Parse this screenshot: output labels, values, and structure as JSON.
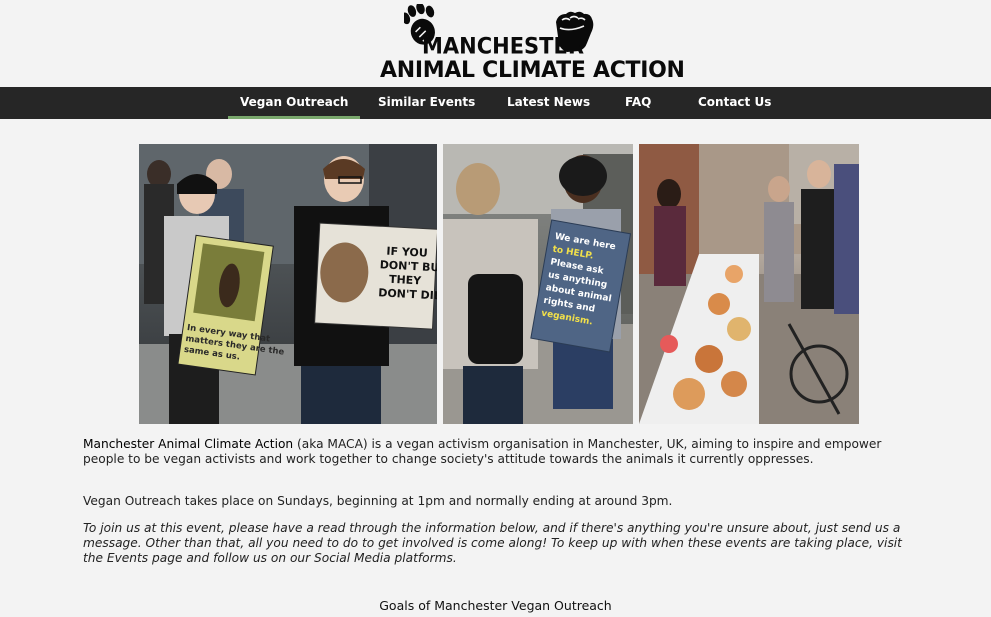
{
  "logo": {
    "line1": "MANCHESTER",
    "line2": "ANIMAL CLIMATE ACTION"
  },
  "nav": {
    "items": [
      {
        "label": "Vegan Outreach",
        "active": true
      },
      {
        "label": "Similar Events",
        "active": false
      },
      {
        "label": "Latest News",
        "active": false
      },
      {
        "label": "FAQ",
        "active": false
      },
      {
        "label": "Contact Us",
        "active": false
      }
    ],
    "accent_color": "#7aa86d",
    "bar_color": "#262626"
  },
  "photos": {
    "sign1_lines": [
      "In every way that",
      "matters they are the",
      "same as us."
    ],
    "sign2_lines": [
      "IF YOU",
      "DON'T BUY",
      "THEY",
      "DON'T DIE!"
    ],
    "sign3_lines": [
      "We are here",
      "to HELP.",
      "Please ask",
      "us anything",
      "about animal",
      "rights and",
      "veganism."
    ]
  },
  "content": {
    "intro_brand": "Manchester Animal Climate Action",
    "intro_rest": " (aka MACA) is a vegan activism organisation in Manchester, UK, aiming to inspire and empower people to be vegan activists and work together to change society's attitude towards the animals it currently oppresses.",
    "when": "Vegan Outreach takes place on Sundays, beginning at 1pm and normally ending at around 3pm.",
    "join": "To join us at this event, please have a read through the information below, and if there's anything you're unsure about, just send us a message. Other than that, all you need to do to get involved is come along! To keep up with when these events are taking place, visit the Events page and follow us on our Social Media platforms.",
    "goals_heading": "Goals of Manchester Vegan Outreach"
  }
}
